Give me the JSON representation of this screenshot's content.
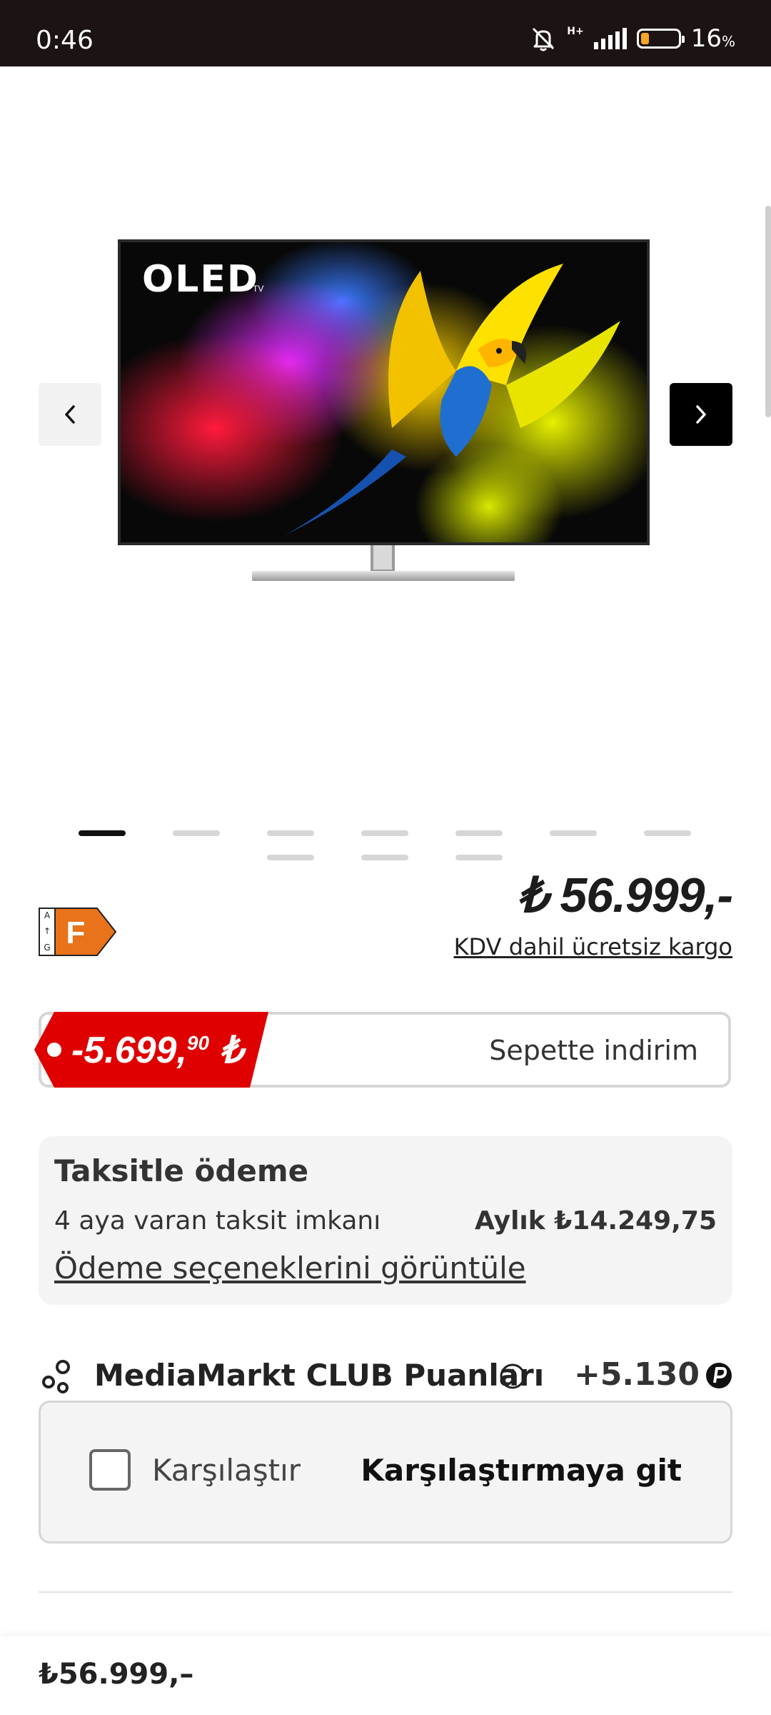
{
  "status_bar": {
    "time": "0:46",
    "network": "H+",
    "battery_percent": "16",
    "battery_unit": "%",
    "battery_level": 0.16,
    "icons": [
      "bell-muted-icon",
      "signal-icon",
      "battery-icon"
    ]
  },
  "gallery": {
    "screen_logo": "OLED",
    "screen_logo_suffix": "TV",
    "total_images": 9,
    "active_index": 0,
    "prev_icon": "chevron-left-icon",
    "next_icon": "chevron-right-icon"
  },
  "product": {
    "energy_class": "F",
    "energy_scale_top": "A",
    "energy_scale_bottom": "G",
    "price": "₺ 56.999,-",
    "shipping_text": "KDV dahil ücretsiz kargo"
  },
  "discount": {
    "amount_main": "-5.699,",
    "amount_cents": "90",
    "currency": " ₺",
    "text": "Sepette indirim",
    "tag_color": "#df0000"
  },
  "installment": {
    "title": "Taksitle ödeme",
    "subtitle": "4 aya varan taksit imkanı",
    "monthly": "Aylık ₺14.249,75",
    "link": "Ödeme seçeneklerini görüntüle"
  },
  "club": {
    "label": "MediaMarkt CLUB Puanları",
    "points": "+5.130"
  },
  "compare": {
    "checkbox_label": "Karşılaştır",
    "link": "Karşılaştırmaya git",
    "checked": false
  },
  "bottom_bar": {
    "price": "₺56.999,–"
  },
  "colors": {
    "accent_red": "#df0000",
    "energy_orange": "#e8731a",
    "status_bar_bg": "#1c1414"
  }
}
